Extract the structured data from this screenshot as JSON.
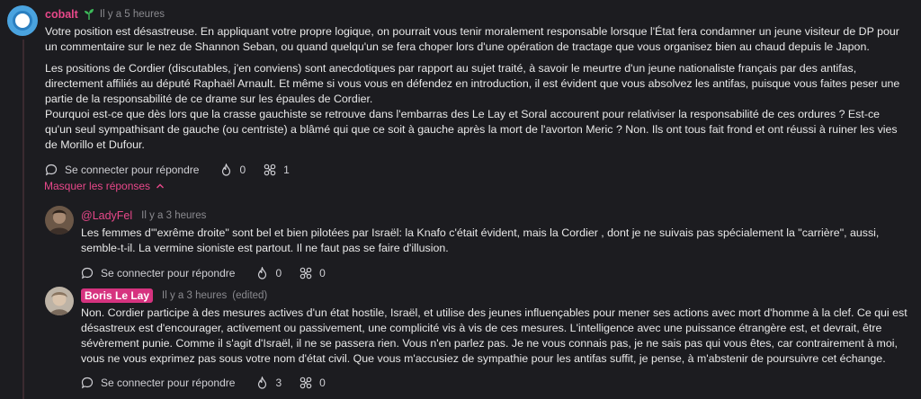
{
  "colors": {
    "accent": "#e8488a",
    "background": "#1c1c20",
    "text": "#e8e8e8",
    "muted": "#8a8a8f"
  },
  "main_comment": {
    "author": "cobalt",
    "time": "Il y a 5 heures",
    "paragraphs": [
      "Votre position est désastreuse. En appliquant votre propre logique, on pourrait vous tenir moralement responsable lorsque l'État fera condamner un jeune visiteur de DP pour un commentaire sur le nez de Shannon Seban, ou quand quelqu'un se fera choper lors d'une opération de tractage que vous organisez bien au chaud depuis le Japon.",
      "Les positions de Cordier (discutables, j'en conviens) sont anecdotiques par rapport au sujet traité, à savoir le meurtre d'un jeune nationaliste français par des antifas, directement affiliés au député Raphaël Arnault. Et même si vous vous en défendez en introduction, il est évident que vous absolvez les antifas, puisque vous faites peser une partie de la responsabilité de ce drame sur les épaules de Cordier.",
      "Pourquoi est-ce que dès lors que la crasse gauchiste se retrouve dans l'embarras des Le Lay et Soral accourent pour relativiser la responsabilité de ces ordures ? Est-ce qu'un seul sympathisant de gauche (ou centriste) a blâmé qui que ce soit à gauche après la mort de l'avorton Meric ? Non. Ils ont tous fait frond et ont réussi à ruiner les vies de Morillo et Dufour."
    ],
    "reply_label": "Se connecter pour répondre",
    "likes": "0",
    "awards": "1"
  },
  "hide_replies_label": "Masquer les réponses",
  "replies": [
    {
      "author": "@LadyFel",
      "time": "Il y a 3 heures",
      "text": "Les femmes d'\"exrême droite\" sont bel et bien pilotées par Israël: la Knafo c'était évident, mais la Cordier , dont je ne suivais pas spécialement la \"carrière\", aussi, semble-t-il. La vermine sioniste est partout. Il ne faut pas se faire d'illusion.",
      "reply_label": "Se connecter pour répondre",
      "likes": "0",
      "awards": "0"
    },
    {
      "author": "Boris Le Lay",
      "time": "Il y a 3 heures",
      "edited": "(edited)",
      "text": "Non. Cordier participe à des mesures actives d'un état hostile, Israël, et utilise des jeunes influençables pour mener ses actions avec mort d'homme à la clef. Ce qui est désastreux est d'encourager, activement ou passivement, une complicité vis à vis de ces mesures. L'intelligence avec une puissance étrangère est, et devrait, être sévèrement punie. Comme il s'agit d'Israël, il ne se passera rien. Vous n'en parlez pas. Je ne vous connais pas, je ne sais pas qui vous êtes, car contrairement à moi, vous ne vous exprimez pas sous votre nom d'état civil. Que vous m'accusiez de sympathie pour les antifas suffit, je pense, à m'abstenir de poursuivre cet échange.",
      "reply_label": "Se connecter pour répondre",
      "likes": "3",
      "awards": "0"
    }
  ]
}
